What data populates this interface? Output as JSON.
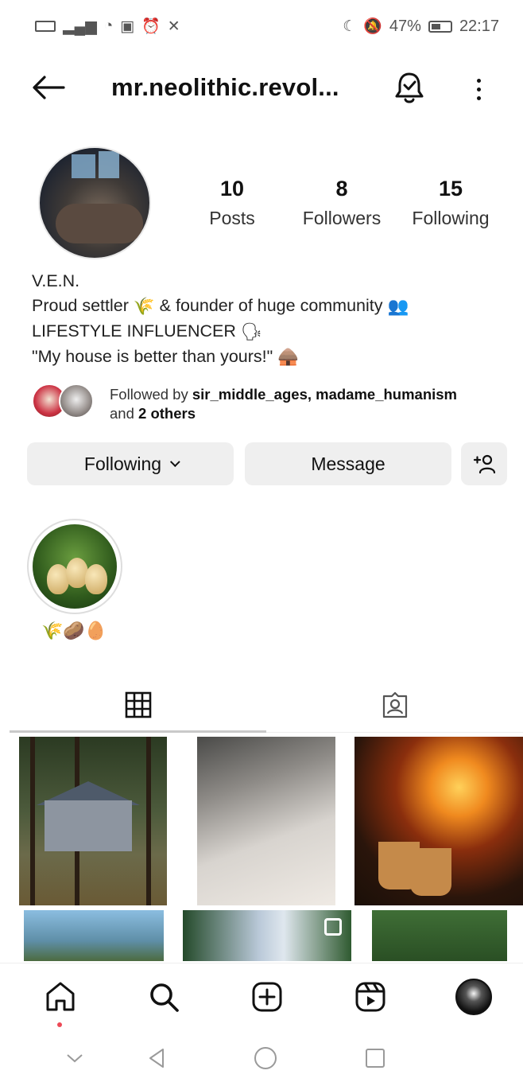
{
  "status_bar": {
    "left_icons": [
      "nfc-icon",
      "signal-icon",
      "wifi-icon",
      "data-icon",
      "alarm-icon",
      "call-muted-icon"
    ],
    "right_icons": [
      "moon-icon",
      "silent-icon"
    ],
    "battery": "47%",
    "time": "22:17"
  },
  "header": {
    "username": "mr.neolithic.revol..."
  },
  "profile": {
    "stats": [
      {
        "value": "10",
        "label": "Posts"
      },
      {
        "value": "8",
        "label": "Followers"
      },
      {
        "value": "15",
        "label": "Following"
      }
    ],
    "bio": {
      "name": "V.E.N.",
      "line1_text": "Proud settler",
      "line1_emoji1": "🌾",
      "line1_text2": "& founder of huge community",
      "line1_emoji2": "👥",
      "line2_text": "LIFESTYLE INFLUENCER",
      "line2_emoji": "🗣",
      "line3_text": "\"My house is better than yours!\"",
      "line3_emoji": "🛖"
    },
    "followed_by": {
      "prefix": "Followed by",
      "names": "sir_middle_ages, madame_humanism",
      "and": "and",
      "others": "2 others"
    },
    "buttons": {
      "following": "Following",
      "message": "Message"
    }
  },
  "highlight": {
    "label": "🌾🥔🥚"
  },
  "tabs": {
    "active": "grid"
  },
  "colors": {
    "accent": "#262626",
    "button_bg": "#efefef",
    "notification_dot": "#ed4956"
  }
}
